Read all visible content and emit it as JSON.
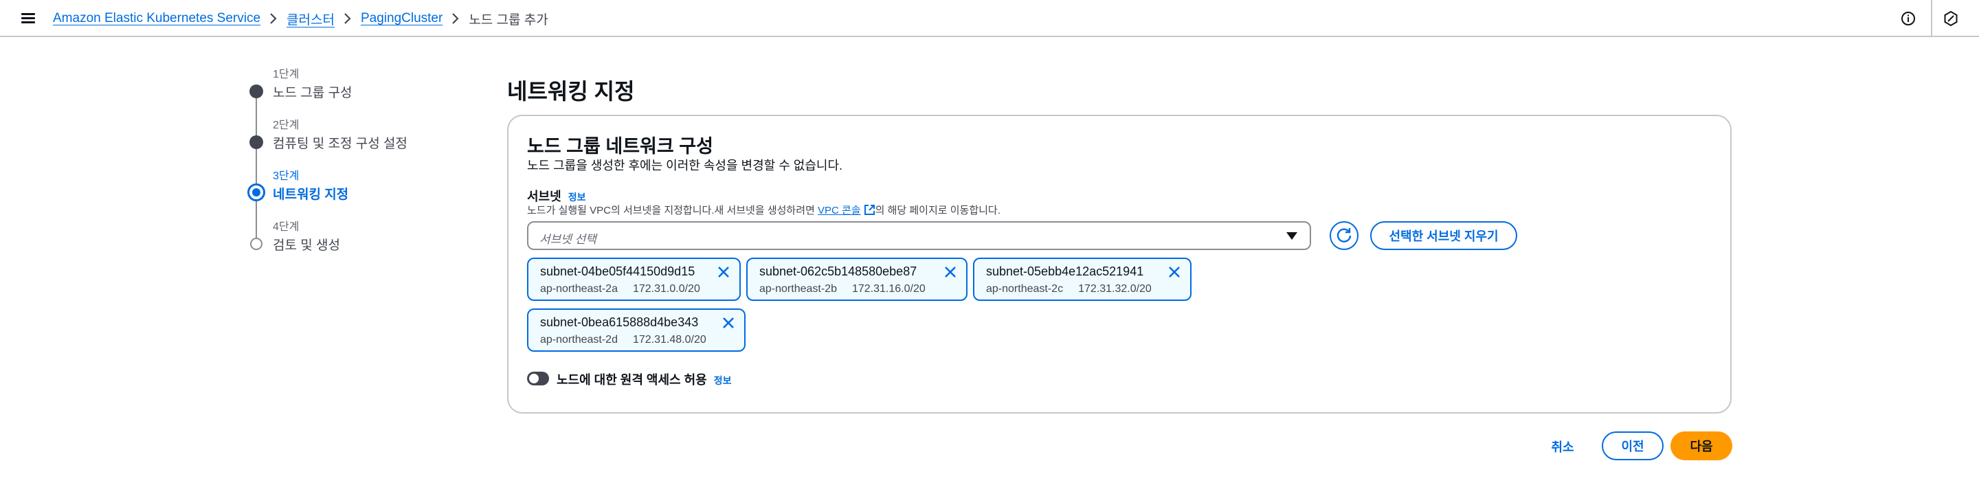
{
  "header": {
    "menu_icon": "hamburger-menu-icon",
    "breadcrumbs": [
      {
        "label": "Amazon Elastic Kubernetes Service"
      },
      {
        "label": "클러스터"
      },
      {
        "label": "PagingCluster"
      },
      {
        "label": "노드 그룹 추가"
      }
    ],
    "right_icons": [
      "info-circle-icon",
      "settings-hexagon-icon"
    ]
  },
  "steps": [
    {
      "number": "1단계",
      "label": "노드 그룹 구성",
      "state": "complete"
    },
    {
      "number": "2단계",
      "label": "컴퓨팅 및 조정 구성 설정",
      "state": "complete"
    },
    {
      "number": "3단계",
      "label": "네트워킹 지정",
      "state": "active"
    },
    {
      "number": "4단계",
      "label": "검토 및 생성",
      "state": "pending"
    }
  ],
  "page": {
    "title": "네트워킹 지정"
  },
  "network": {
    "title": "노드 그룹 네트워크 구성",
    "description": "노드 그룹을 생성한 후에는 이러한 속성을 변경할 수 없습니다.",
    "subnets": {
      "label": "서브넷",
      "info": "정보",
      "desc_before": "노드가 실행될 VPC의 서브넷을 지정합니다.새 서브넷을 생성하려면 ",
      "desc_link": "VPC 콘솔",
      "desc_after": "의 해당 페이지로 이동합니다.",
      "placeholder": "서브넷 선택",
      "clear_label": "선택한 서브넷 지우기",
      "selected": [
        {
          "id": "subnet-04be05f44150d9d15",
          "az": "ap-northeast-2a",
          "cidr": "172.31.0.0/20"
        },
        {
          "id": "subnet-062c5b148580ebe87",
          "az": "ap-northeast-2b",
          "cidr": "172.31.16.0/20"
        },
        {
          "id": "subnet-05ebb4e12ac521941",
          "az": "ap-northeast-2c",
          "cidr": "172.31.32.0/20"
        },
        {
          "id": "subnet-0bea615888d4be343",
          "az": "ap-northeast-2d",
          "cidr": "172.31.48.0/20"
        }
      ]
    },
    "remote_access": {
      "label": "노드에 대한 원격 액세스 허용",
      "info": "정보",
      "enabled": false
    }
  },
  "actions": {
    "cancel": "취소",
    "previous": "이전",
    "next": "다음"
  },
  "colors": {
    "link": "#006ce0",
    "primary": "#ff9900",
    "token_bg": "#f0fbff"
  }
}
